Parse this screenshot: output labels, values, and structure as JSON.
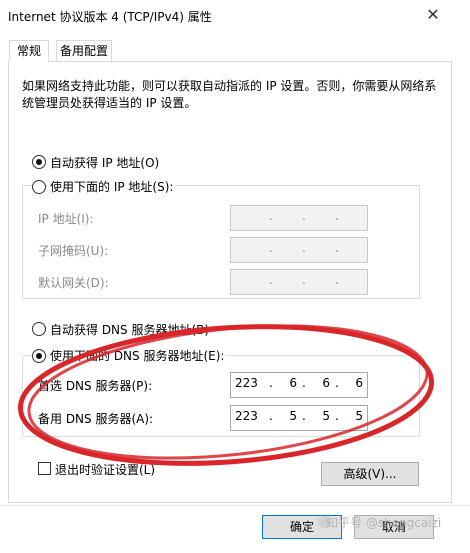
{
  "window": {
    "title": "Internet 协议版本 4 (TCP/IPv4) 属性",
    "close_glyph": "✕"
  },
  "tabs": [
    {
      "label": "常规"
    },
    {
      "label": "备用配置"
    }
  ],
  "description": "如果网络支持此功能，则可以获取自动指派的 IP 设置。否则，你需要从网络系统管理员处获得适当的 IP 设置。",
  "ip": {
    "auto_label": "自动获得 IP 地址(O)",
    "auto_selected": true,
    "manual_label": "使用下面的 IP 地址(S):",
    "fields": [
      {
        "label": "IP 地址(I):",
        "octets": [
          "",
          "",
          "",
          ""
        ]
      },
      {
        "label": "子网掩码(U):",
        "octets": [
          "",
          "",
          "",
          ""
        ]
      },
      {
        "label": "默认网关(D):",
        "octets": [
          "",
          "",
          "",
          ""
        ]
      }
    ]
  },
  "dns": {
    "auto_label": "自动获得 DNS 服务器地址(B)",
    "manual_label": "使用下面的 DNS 服务器地址(E):",
    "manual_selected": true,
    "fields": [
      {
        "label": "首选 DNS 服务器(P):",
        "octets": [
          "223",
          "6",
          "6",
          "6"
        ]
      },
      {
        "label": "备用 DNS 服务器(A):",
        "octets": [
          "223",
          "5",
          "5",
          "5"
        ]
      }
    ]
  },
  "validate_on_exit_label": "退出时验证设置(L)",
  "advanced_button": "高级(V)...",
  "ok_button": "确定",
  "cancel_button": "取消",
  "watermark": "知乎号 @shengcaizi",
  "annotation_color": "#d9262a"
}
